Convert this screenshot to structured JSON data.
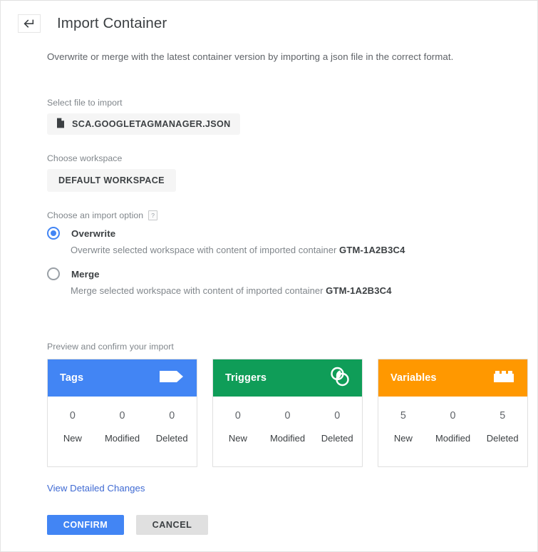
{
  "header": {
    "back_icon": "back-arrow-icon",
    "title": "Import Container",
    "subtitle": "Overwrite or merge with the latest container version by importing a json file in the correct format."
  },
  "select_file": {
    "label": "Select file to import",
    "file_icon": "file-document-icon",
    "filename": "SCA.GOOGLETAGMANAGER.JSON"
  },
  "workspace": {
    "label": "Choose workspace",
    "selected": "DEFAULT WORKSPACE"
  },
  "import_option": {
    "label": "Choose an import option",
    "help_icon": "help-question-icon",
    "options": [
      {
        "id": "overwrite",
        "label": "Overwrite",
        "description_prefix": "Overwrite selected workspace with content of imported container ",
        "container_id": "GTM-1A2B3C4",
        "selected": true
      },
      {
        "id": "merge",
        "label": "Merge",
        "description_prefix": "Merge selected workspace with content of imported container ",
        "container_id": "GTM-1A2B3C4",
        "selected": false
      }
    ]
  },
  "preview": {
    "label": "Preview and confirm your import",
    "stat_names": [
      "New",
      "Modified",
      "Deleted"
    ],
    "cards": [
      {
        "title": "Tags",
        "icon": "tag-icon",
        "color": "#4285f4",
        "values": [
          0,
          0,
          0
        ]
      },
      {
        "title": "Triggers",
        "icon": "trigger-circles-icon",
        "color": "#0f9d58",
        "values": [
          0,
          0,
          0
        ]
      },
      {
        "title": "Variables",
        "icon": "lego-brick-icon",
        "color": "#ff9800",
        "values": [
          5,
          0,
          5
        ]
      }
    ]
  },
  "detail_link": "View Detailed Changes",
  "actions": {
    "confirm": "CONFIRM",
    "cancel": "CANCEL"
  },
  "colors": {
    "accent_blue": "#4285f4",
    "green": "#0f9d58",
    "orange": "#ff9800",
    "link": "#3f6ad3",
    "text": "#3c4043",
    "muted": "#80868b"
  }
}
